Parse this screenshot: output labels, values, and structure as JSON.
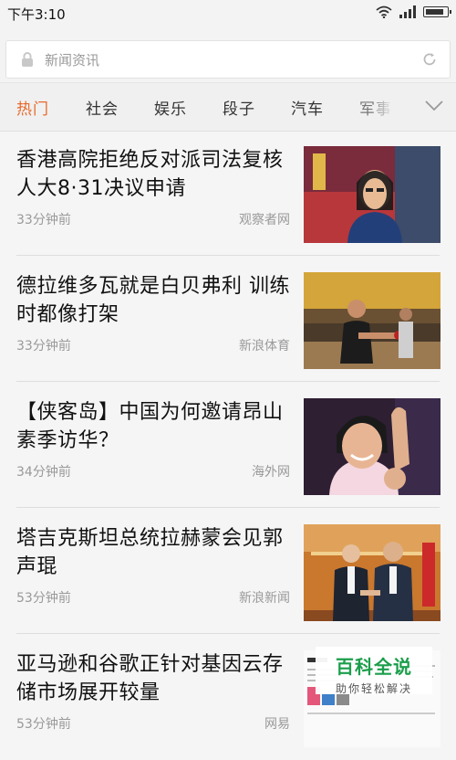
{
  "status": {
    "time": "下午3:10",
    "battery_level": 0.9
  },
  "search": {
    "placeholder": "新闻资讯"
  },
  "tabs": [
    "热门",
    "社会",
    "娱乐",
    "段子",
    "汽车",
    "军事"
  ],
  "active_tab": "热门",
  "news": [
    {
      "title": "香港高院拒绝反对派司法复核人大8·31决议申请",
      "time": "33分钟前",
      "source": "观察者网"
    },
    {
      "title": "德拉维多瓦就是白贝弗利 训练时都像打架",
      "time": "33分钟前",
      "source": "新浪体育"
    },
    {
      "title": "【侠客岛】中国为何邀请昂山素季访华？",
      "time": "34分钟前",
      "source": "海外网"
    },
    {
      "title": "塔吉克斯坦总统拉赫蒙会见郭声琨",
      "time": "53分钟前",
      "source": "新浪新闻"
    },
    {
      "title": "亚马逊和谷歌正针对基因云存储市场展开较量",
      "time": "53分钟前",
      "source": "网易"
    }
  ],
  "watermark": {
    "logo": "百科全说",
    "subtitle": "助你轻松解决"
  },
  "colors": {
    "accent": "#e8692c",
    "background": "#f5f5f5",
    "watermark": "#1b9e4b"
  },
  "icons": {
    "lock": "lock-icon",
    "refresh": "refresh-icon",
    "more": "chevron-down-icon"
  }
}
